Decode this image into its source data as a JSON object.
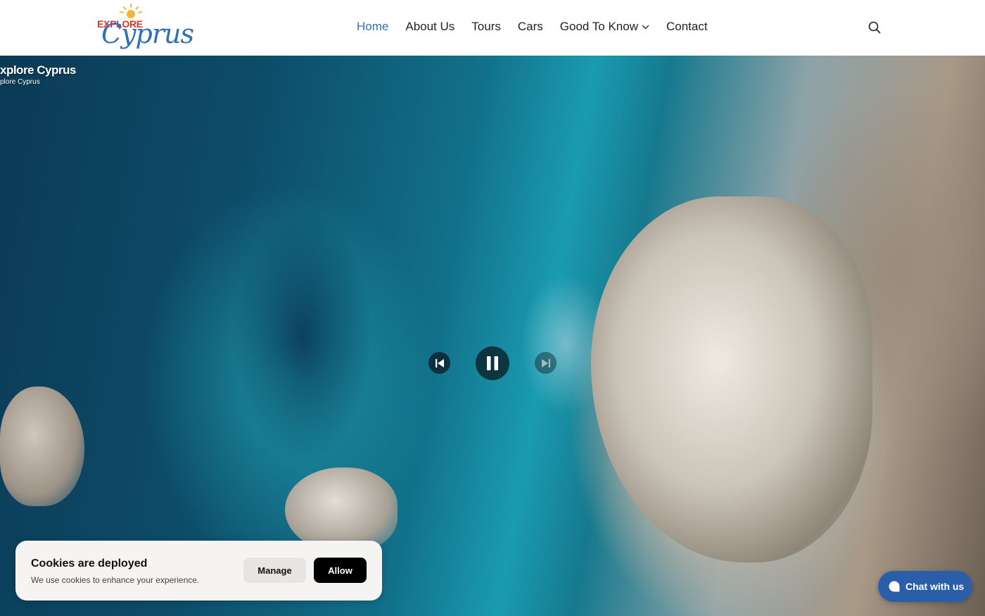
{
  "logo": {
    "word_top": "EXPLORE",
    "word_main": "Cyprus"
  },
  "nav": {
    "items": [
      {
        "label": "Home",
        "active": true
      },
      {
        "label": "About Us"
      },
      {
        "label": "Tours"
      },
      {
        "label": "Cars"
      },
      {
        "label": "Good To Know",
        "has_dropdown": true
      },
      {
        "label": "Contact"
      }
    ]
  },
  "header": {
    "search_icon": "search-icon"
  },
  "hero": {
    "video_title": "xplore Cyprus",
    "video_subtitle": "plore Cyprus",
    "controls": [
      "previous-icon",
      "pause-icon",
      "next-icon"
    ]
  },
  "cookie": {
    "title": "Cookies are deployed",
    "text": "We use cookies to enhance your experience.",
    "manage_label": "Manage",
    "allow_label": "Allow"
  },
  "chat": {
    "label": "Chat with us",
    "color": "#2a5ea8"
  },
  "colors": {
    "nav_active": "#3c6fb0",
    "logo_red": "#d8352a",
    "logo_blue": "#2f70b8",
    "logo_sun": "#f2b632"
  }
}
